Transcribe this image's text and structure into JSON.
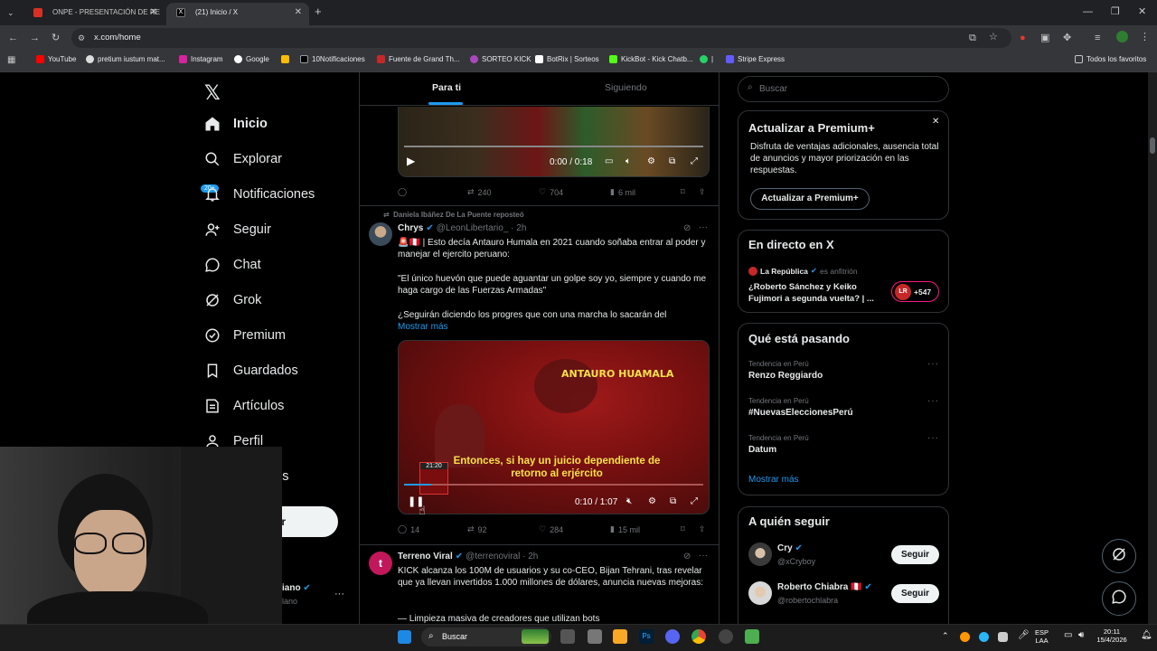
{
  "browser": {
    "tabs": [
      {
        "title": "ONPE - PRESENTACIÓN DE RE",
        "active": false
      },
      {
        "title": "(21) Inicio / X",
        "active": true
      }
    ],
    "url": "x.com/home",
    "bookmarks": [
      "YouTube",
      "pretium iustum mat...",
      "Instagram",
      "Google",
      "10Notificaciones",
      "Fuente de Grand Th...",
      "SORTEO KICK",
      "BotRix | Sorteos",
      "KickBot - Kick Chatb...",
      "|",
      "Stripe Express"
    ],
    "all_bookmarks": "Todos los favoritos"
  },
  "sidebar": {
    "items": [
      {
        "label": "Inicio",
        "icon": "home-icon"
      },
      {
        "label": "Explorar",
        "icon": "search-icon"
      },
      {
        "label": "Notificaciones",
        "icon": "bell-icon"
      },
      {
        "label": "Seguir",
        "icon": "add-user-icon"
      },
      {
        "label": "Chat",
        "icon": "chat-icon"
      },
      {
        "label": "Grok",
        "icon": "grok-icon"
      },
      {
        "label": "Premium",
        "icon": "premium-icon"
      },
      {
        "label": "Guardados",
        "icon": "bookmark-icon"
      },
      {
        "label": "Artículos",
        "icon": "articles-icon"
      },
      {
        "label": "Perfil",
        "icon": "profile-icon"
      },
      {
        "label": "ones",
        "icon": "more-icon"
      }
    ],
    "notif_badge": "20+",
    "post_button_partial": "r",
    "account_name_partial": "iano",
    "account_handle_partial": "lano",
    "account_more": "···"
  },
  "feed": {
    "tabs": [
      "Para ti",
      "Siguiendo"
    ],
    "post1": {
      "video_time": "0:00 / 0:18",
      "replies": "",
      "reposts": "240",
      "likes": "704",
      "views": "6 mil"
    },
    "post2": {
      "reposted_by": "Daniela Ibáñez De La Puente reposteó",
      "name": "Chrys",
      "handle": "@LeonLibertario_ · 2h",
      "text1": "🚨🇵🇪 | Esto decía Antauro Humala en 2021 cuando soñaba entrar al poder y manejar el ejercito peruano:",
      "text2": "\"El único huevón que puede aguantar un golpe soy yo, siempre y cuando me haga cargo de las Fuerzas Armadas\"",
      "text3": "¿Seguirán diciendo los progres que con una marcha lo sacarán del",
      "show_more": "Mostrar más",
      "video_overlay_name": "ANTAURO HUAMALA",
      "video_caption": "Entonces, si hay un juicio dependiente de retorno al erjército",
      "video_thumb_time": "21:20",
      "video_time": "0:10 / 1:07",
      "replies": "14",
      "reposts": "92",
      "likes": "284",
      "views": "15 mil"
    },
    "post3": {
      "name": "Terreno Viral",
      "handle": "@terrenoviral · 2h",
      "text": "KICK alcanza los 100M de usuarios y su co-CEO, Bijan Tehrani, tras revelar que ya llevan invertidos 1.000 millones de dólares, anuncia nuevas mejoras:",
      "text2": "— Limpieza masiva de creadores que utilizan bots"
    }
  },
  "right": {
    "search_placeholder": "Buscar",
    "premium": {
      "title": "Actualizar a Premium+",
      "body": "Disfruta de ventajas adicionales, ausencia total de anuncios y mayor priorización en las respuestas.",
      "button": "Actualizar a Premium+"
    },
    "live": {
      "title": "En directo en X",
      "host": "La República",
      "host_suffix": "es anfitrión",
      "headline": "¿Roberto Sánchez y Keiko Fujimori a segunda vuelta? | ...",
      "listeners": "+547",
      "logo": "LR"
    },
    "trends": {
      "title": "Qué está pasando",
      "items": [
        {
          "context": "Tendencia en Perú",
          "name": "Renzo Reggiardo"
        },
        {
          "context": "Tendencia en Perú",
          "name": "#NuevasEleccionesPerú"
        },
        {
          "context": "Tendencia en Perú",
          "name": "Datum"
        }
      ],
      "show_more": "Mostrar más"
    },
    "who_to_follow": {
      "title": "A quién seguir",
      "items": [
        {
          "name": "Cry",
          "handle": "@xCryboy",
          "button": "Seguir"
        },
        {
          "name": "Roberto Chiabra 🇵🇪",
          "handle": "@robertochlabra",
          "button": "Seguir"
        }
      ]
    }
  },
  "taskbar": {
    "search": "Buscar",
    "lang": "ESP\nLAA",
    "time": "20:11",
    "date": "15/4/2026"
  }
}
